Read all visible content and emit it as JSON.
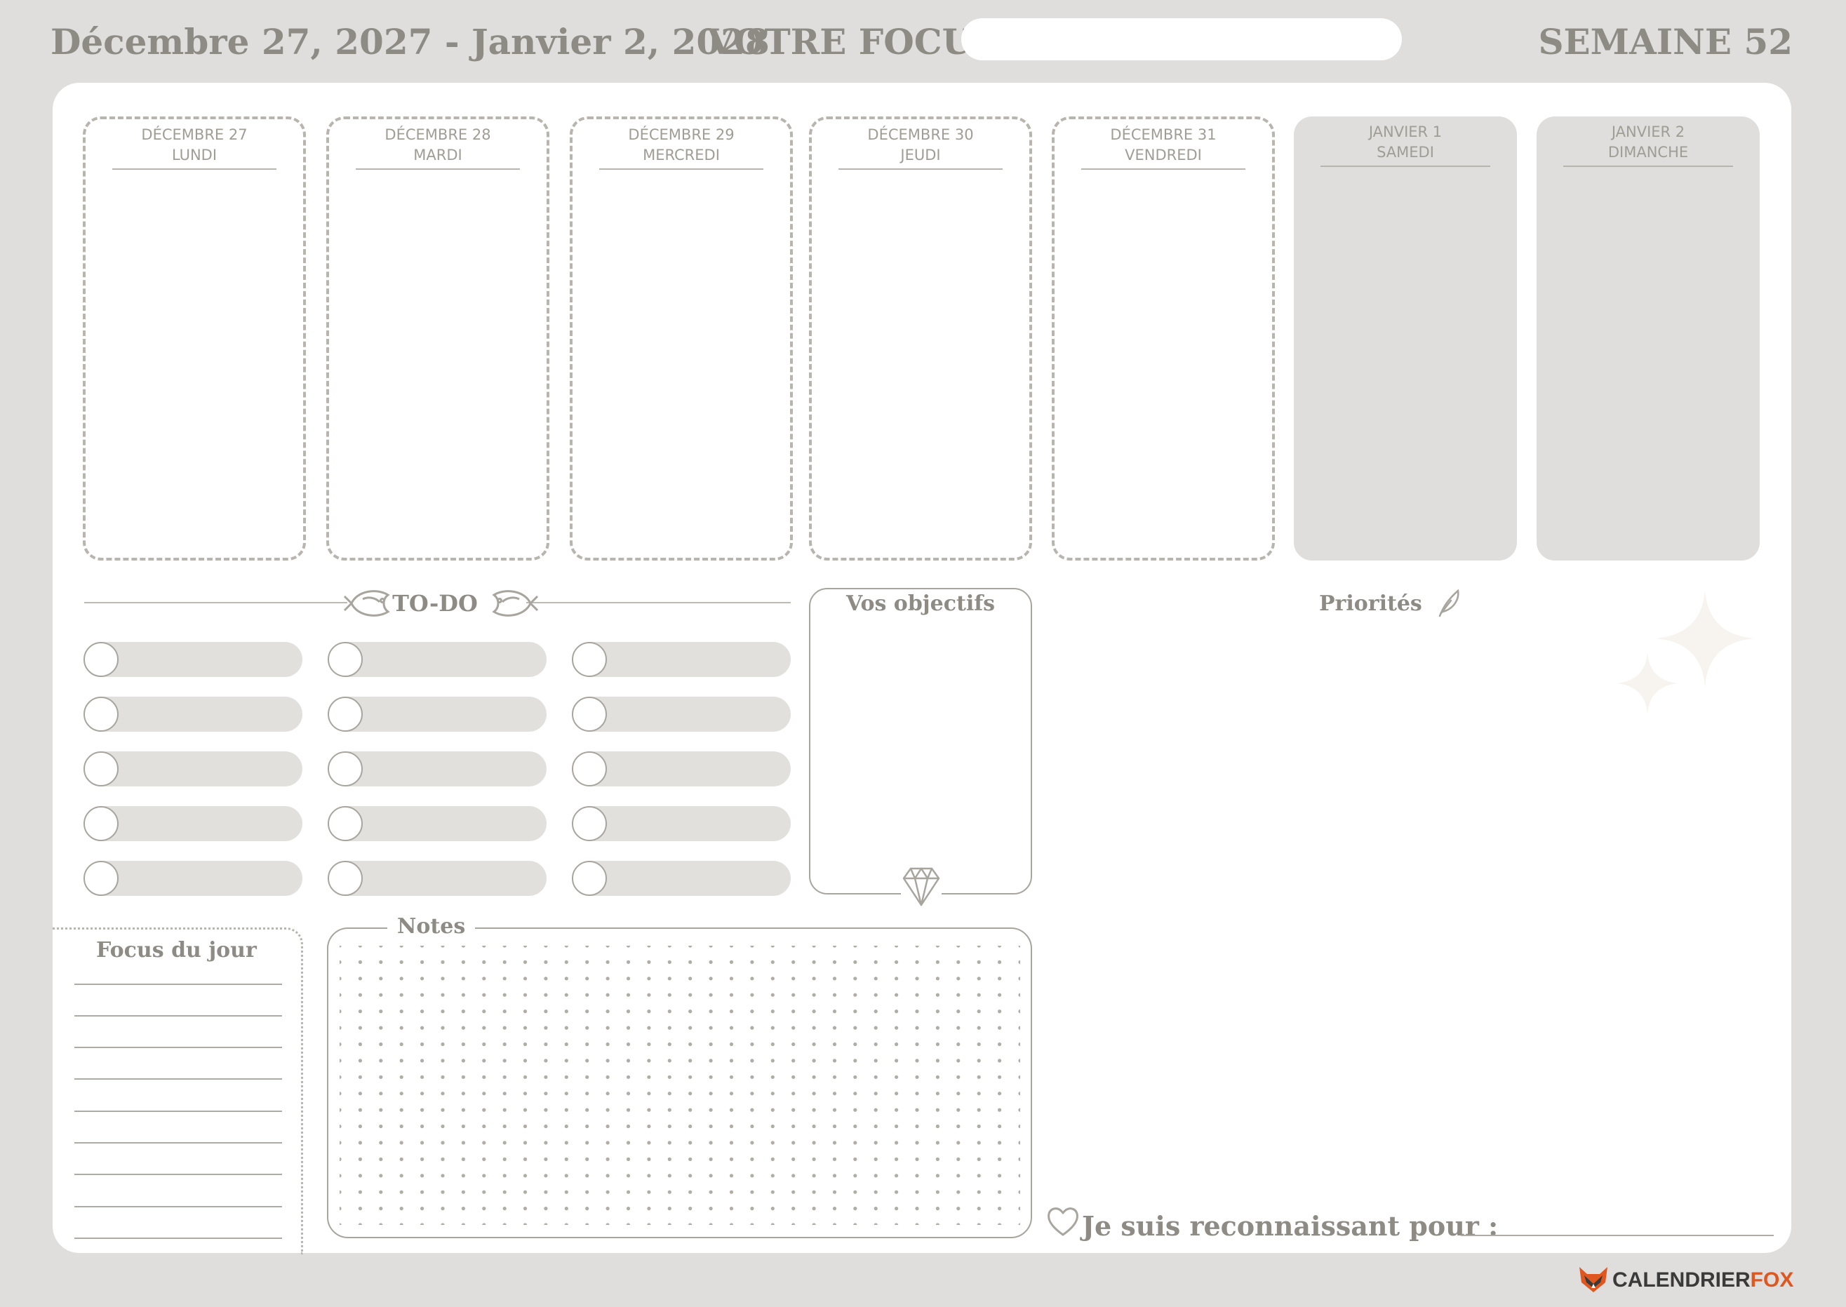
{
  "header": {
    "date_range": "Décembre 27, 2027 - Janvier 2, 2028",
    "focus_label": "VOTRE FOCUS :",
    "focus_value": "",
    "week": "SEMAINE 52"
  },
  "days": [
    {
      "date": "DÉCEMBRE 27",
      "weekday": "LUNDI",
      "weekend": false
    },
    {
      "date": "DÉCEMBRE 28",
      "weekday": "MARDI",
      "weekend": false
    },
    {
      "date": "DÉCEMBRE 29",
      "weekday": "MERCREDI",
      "weekend": false
    },
    {
      "date": "DÉCEMBRE 30",
      "weekday": "JEUDI",
      "weekend": false
    },
    {
      "date": "DÉCEMBRE 31",
      "weekday": "VENDREDI",
      "weekend": false
    },
    {
      "date": "JANVIER 1",
      "weekday": "SAMEDI",
      "weekend": true
    },
    {
      "date": "JANVIER 2",
      "weekday": "DIMANCHE",
      "weekend": true
    }
  ],
  "todo": {
    "title": "TO-DO",
    "columns": 3,
    "rows": 5
  },
  "objectifs": {
    "title": "Vos objectifs"
  },
  "priorites": {
    "title": "Priorités"
  },
  "focus_jour": {
    "title": "Focus du jour",
    "lines": 9
  },
  "notes": {
    "title": "Notes"
  },
  "gratitude": {
    "label": "Je suis reconnaissant pour :"
  },
  "brand": {
    "name_part1": "CALENDRIER",
    "name_part2": "FOX",
    "accent": "#e0561f",
    "dark": "#3a3a3a"
  },
  "colors": {
    "background": "#dfdedc",
    "sheet": "#ffffff",
    "text": "#8e8b85",
    "line": "#b8b5ae",
    "pill": "#e1e0dd"
  },
  "icons": [
    "fish-icon",
    "diamond-icon",
    "quill-icon",
    "sparkle-icon",
    "heart-icon",
    "fox-logo-icon"
  ]
}
